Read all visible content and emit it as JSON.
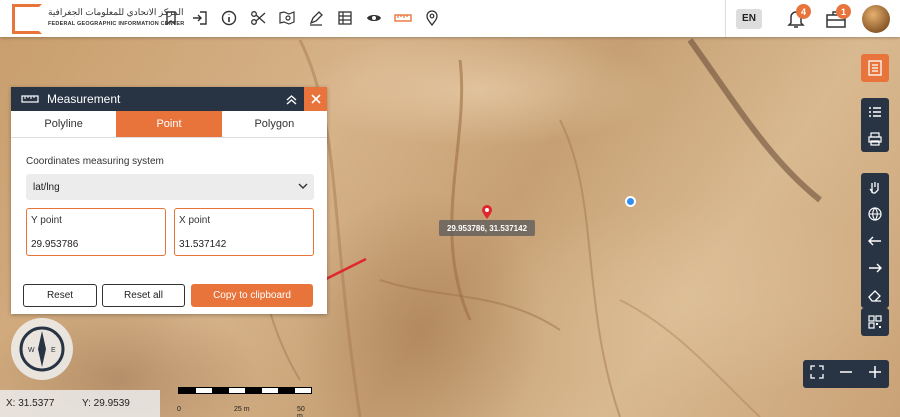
{
  "header": {
    "logo_arabic": "المركز الاتحادي للمعلومات الجغرافية",
    "logo_english": "FEDERAL GEOGRAPHIC INFORMATION CENTER",
    "language": "EN",
    "notifications_count": "4",
    "tasks_count": "1",
    "tools": [
      "bookmark-icon",
      "login-icon",
      "info-icon",
      "scissors-icon",
      "map-search-icon",
      "draw-icon",
      "table-icon",
      "eye-icon",
      "ruler-icon",
      "location-pin-icon"
    ],
    "active_tool": "ruler-icon"
  },
  "measurement": {
    "title": "Measurement",
    "tabs": [
      "Polyline",
      "Point",
      "Polygon"
    ],
    "active_tab": "Point",
    "system_label": "Coordinates measuring system",
    "system_value": "lat/lng",
    "y_label": "Y point",
    "y_value": "29.953786",
    "x_label": "X point",
    "x_value": "31.537142",
    "reset_label": "Reset",
    "reset_all_label": "Reset all",
    "copy_label": "Copy to clipboard"
  },
  "map": {
    "point_label": "29.953786, 31.537142",
    "cursor_x": "X: 31.5377",
    "cursor_y": "Y: 29.9539",
    "scale_labels": [
      "0",
      "25 m",
      "50 m"
    ]
  },
  "colors": {
    "accent": "#e8743b",
    "dark": "#283444",
    "location_dot": "#2f8ff0"
  }
}
